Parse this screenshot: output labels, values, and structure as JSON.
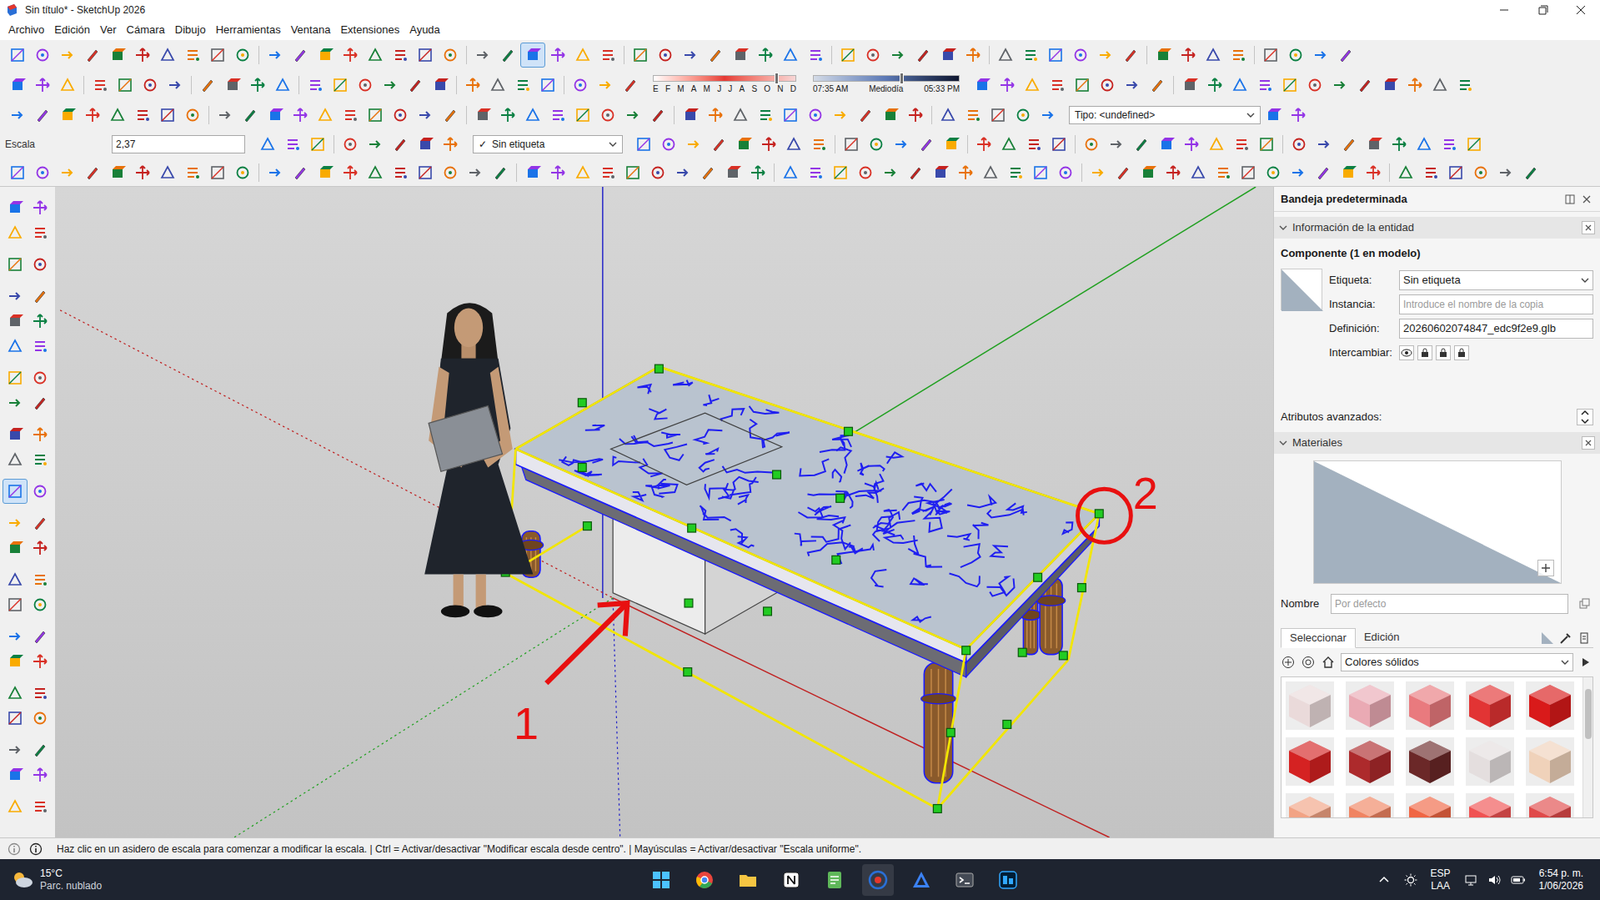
{
  "window": {
    "title": "Sin título* - SketchUp 2026"
  },
  "menu": [
    "Archivo",
    "Edición",
    "Ver",
    "Cámara",
    "Dibujo",
    "Herramientas",
    "Ventana",
    "Extensiones",
    "Ayuda"
  ],
  "scale_tool": {
    "selected": true
  },
  "shadows": {
    "months": [
      "E",
      "F",
      "M",
      "A",
      "M",
      "J",
      "J",
      "A",
      "S",
      "O",
      "N",
      "D"
    ],
    "month_level": 0.85,
    "sunrise": "07:35 AM",
    "noon": "Mediodía",
    "sunset": "05:33 PM",
    "time_level": 0.59
  },
  "type_dropdown": "Tipo: <undefined>",
  "measurements": {
    "label": "Escala",
    "value": "2,37"
  },
  "tag_dropdown": {
    "check": "✓",
    "value": "Sin etiqueta"
  },
  "viewport": {
    "annotations": [
      {
        "label": "1"
      },
      {
        "label": "2"
      }
    ]
  },
  "tray": {
    "title": "Bandeja predeterminada",
    "entity_info": {
      "header": "Información de la entidad",
      "expanded": true,
      "kind_label": "Componente (1 en modelo)",
      "fields": [
        {
          "label": "Etiqueta:",
          "value": "Sin etiqueta",
          "kind": "dropdown"
        },
        {
          "label": "Instancia:",
          "placeholder": "Introduce el nombre de la copia",
          "kind": "input"
        },
        {
          "label": "Definición:",
          "value": "20260602074847_edc9f2e9.glb",
          "kind": "input"
        },
        {
          "label": "Intercambiar:",
          "kind": "icons"
        }
      ],
      "advanced": "Atributos avanzados:"
    },
    "materials": {
      "header": "Materiales",
      "expanded": true,
      "name_label": "Nombre",
      "name_placeholder": "Por defecto",
      "tabs": [
        {
          "label": "Seleccionar",
          "selected": true
        },
        {
          "label": "Edición",
          "selected": false
        }
      ],
      "library": "Colores sólidos",
      "swatches": [
        {
          "color": "#eadada"
        },
        {
          "color": "#eaaab4"
        },
        {
          "color": "#e97a7e"
        },
        {
          "color": "#e23434"
        },
        {
          "color": "#d91a1a"
        },
        {
          "color": "#d52222"
        },
        {
          "color": "#ad2a2c"
        },
        {
          "color": "#6b2828"
        },
        {
          "color": "#e4dede"
        },
        {
          "color": "#f0d2ba"
        },
        {
          "color": "#f2a384"
        },
        {
          "color": "#f08462"
        },
        {
          "color": "#f06644"
        },
        {
          "color": "#f05252"
        },
        {
          "color": "#e04a4a"
        }
      ]
    }
  },
  "status_bar": "Haz clic en un asidero de escala para comenzar a modificar la escala. | Ctrl = Activar/desactivar \"Modificar escala desde centro\". | Mayúsculas = Activar/desactivar \"Escala uniforme\".",
  "taskbar": {
    "temp": "15°C",
    "weather": "Parc. nublado",
    "lang": "ESP",
    "lang_sub": "LAA",
    "time": "6:54 p. m.",
    "date": "1/06/2026"
  }
}
